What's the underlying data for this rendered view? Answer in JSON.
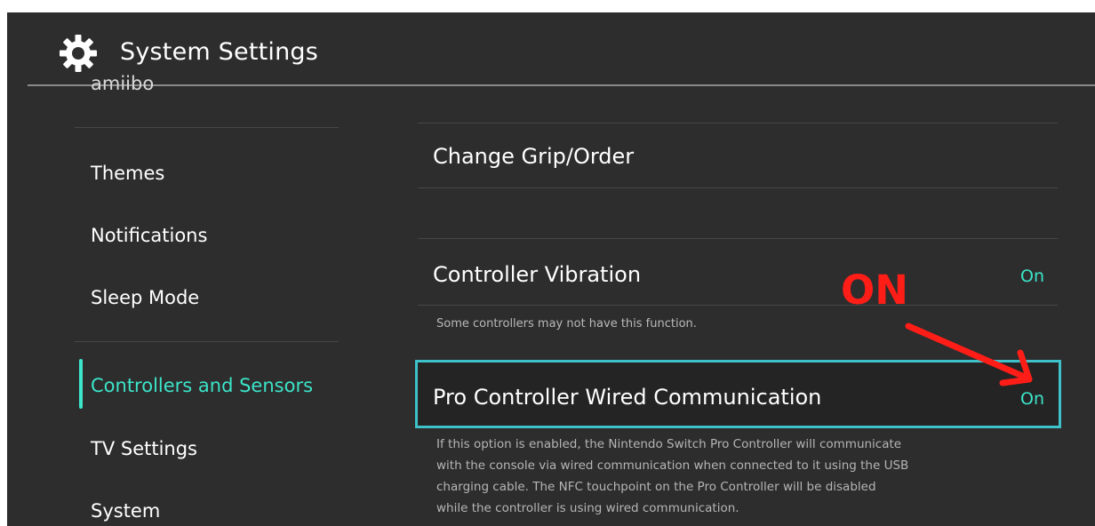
{
  "header": {
    "title": "System Settings",
    "icon": "gear-icon"
  },
  "sidebar": {
    "cut_item": "amiibo",
    "items": [
      {
        "label": "Themes"
      },
      {
        "label": "Notifications"
      },
      {
        "label": "Sleep Mode"
      },
      {
        "label": "Controllers and Sensors",
        "active": true
      },
      {
        "label": "TV Settings"
      },
      {
        "label": "System"
      }
    ]
  },
  "main": {
    "change_grip": {
      "label": "Change Grip/Order"
    },
    "vibration": {
      "label": "Controller Vibration",
      "value": "On",
      "description": "Some controllers may not have this function."
    },
    "wired": {
      "label": "Pro Controller Wired Communication",
      "value": "On",
      "description_lines": [
        "If this option is enabled, the Nintendo Switch Pro Controller will communicate",
        "with the console via wired communication when connected to it using the USB",
        "charging cable. The NFC touchpoint on the Pro Controller will be disabled",
        "while the controller is using wired communication."
      ]
    }
  },
  "annotation": {
    "text": "ON",
    "color": "#ff1d17"
  },
  "colors": {
    "accent": "#3ce4c9",
    "selection_border": "#3ec1c8",
    "background": "#2d2d2d"
  }
}
